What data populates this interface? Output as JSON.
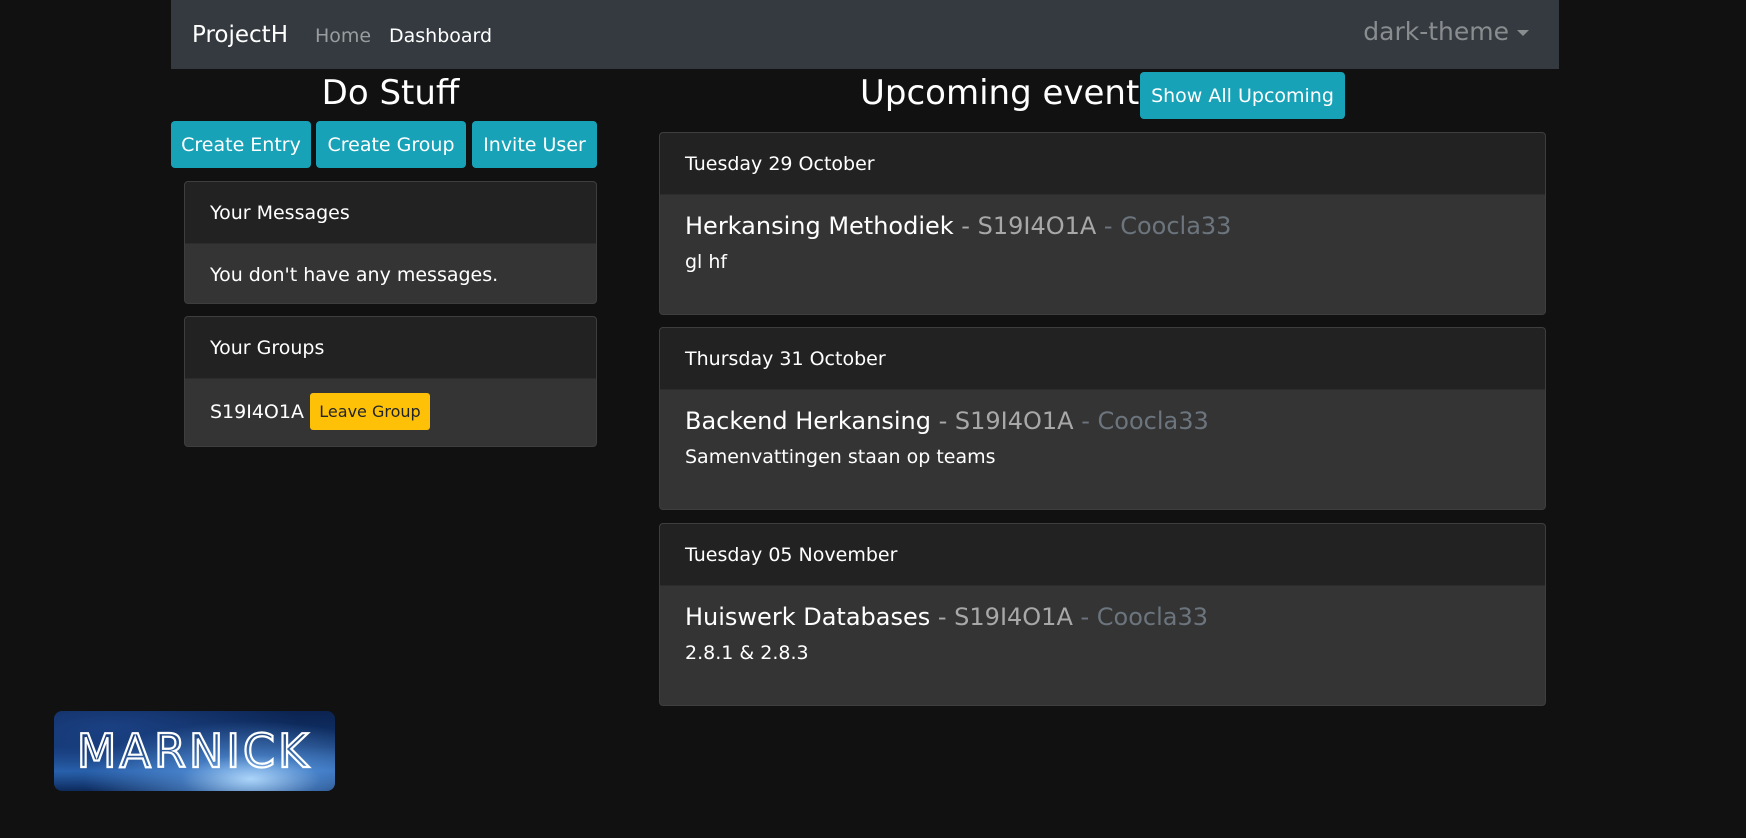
{
  "navbar": {
    "brand": "ProjectH",
    "links": [
      {
        "label": "Home",
        "active": false
      },
      {
        "label": "Dashboard",
        "active": true
      }
    ],
    "theme_dropdown": {
      "label": "dark-theme",
      "icon": "caret-down-icon"
    }
  },
  "left": {
    "title": "Do Stuff",
    "buttons": [
      "Create Entry",
      "Create Group",
      "Invite User"
    ],
    "messages": {
      "header": "Your Messages",
      "body": "You don't have any messages."
    },
    "groups": {
      "header": "Your Groups",
      "items": [
        {
          "name": "S19I4O1A",
          "action": "Leave Group"
        }
      ]
    }
  },
  "right": {
    "title": "Upcoming events",
    "show_all_label": "Show All Upcoming",
    "events": [
      {
        "date": "Tuesday 29 October",
        "title": "Herkansing Methodiek",
        "sep1": " - ",
        "group": "S19I4O1A",
        "sep2": " - ",
        "user": "Coocla33",
        "description": "gl hf"
      },
      {
        "date": "Thursday 31 October",
        "title": "Backend Herkansing",
        "sep1": " - ",
        "group": "S19I4O1A",
        "sep2": " - ",
        "user": "Coocla33",
        "description": "Samenvattingen staan op teams"
      },
      {
        "date": "Tuesday 05 November",
        "title": "Huiswerk Databases",
        "sep1": " - ",
        "group": "S19I4O1A",
        "sep2": " - ",
        "user": "Coocla33",
        "description": "2.8.1 & 2.8.3"
      }
    ]
  },
  "logo": {
    "text": "MARNICK"
  },
  "colors": {
    "background": "#111111",
    "navbar": "#343a40",
    "info": "#17a2b8",
    "warning": "#ffc107",
    "card_body": "#343434",
    "card_header": "#222222",
    "muted": "#6c757d"
  }
}
